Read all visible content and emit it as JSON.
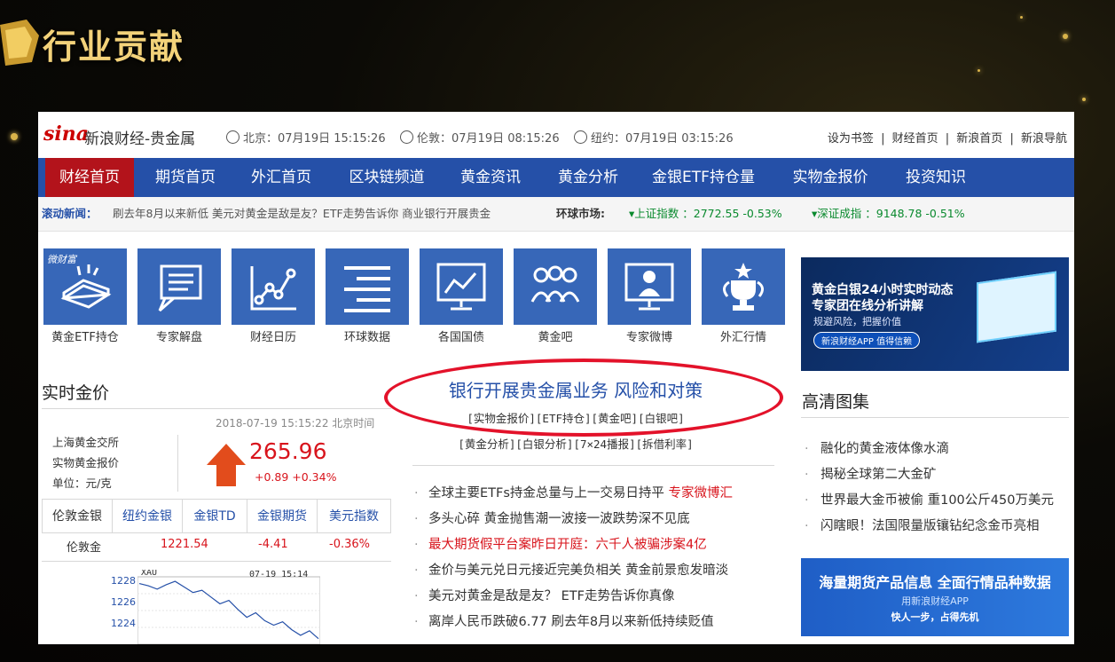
{
  "slide_title": "行业贡献",
  "site": {
    "logo": "sina",
    "name": "新浪财经-贵金属",
    "clocks": [
      "北京：07月19日 15:15:26",
      "伦敦：07月19日 08:15:26",
      "纽约：07月19日 03:15:26"
    ],
    "top_links": [
      "设为书签",
      "|",
      "财经首页",
      "|",
      "新浪首页",
      "|",
      "新浪导航"
    ]
  },
  "nav": [
    "财经首页",
    "期货首页",
    "外汇首页",
    "区块链频道",
    "黄金资讯",
    "黄金分析",
    "金银ETF持仓量",
    "实物金报价",
    "投资知识"
  ],
  "ticker": {
    "label": "滚动新闻：",
    "news": "刷去年8月以来新低   美元对黄金是敌是友？ETF走势告诉你   商业银行开展贵金",
    "market_label": "环球市场:",
    "index1": "▾上证指数 ：2772.55 -0.53%",
    "index2": "▾深证成指 ：9148.78 -0.51%"
  },
  "tiles": [
    {
      "label": "黄金ETF持仓",
      "badge": "微财富"
    },
    {
      "label": "专家解盘"
    },
    {
      "label": "财经日历"
    },
    {
      "label": "环球数据"
    },
    {
      "label": "各国国债"
    },
    {
      "label": "黄金吧"
    },
    {
      "label": "专家微博"
    },
    {
      "label": "外汇行情"
    }
  ],
  "ad1": {
    "line1": "黄金白银24小时实时动态",
    "line2": "专家团在线分析讲解",
    "line3": "规避风险，把握价值",
    "button": "新浪财经APP 值得信赖"
  },
  "realtime": {
    "title": "实时金价",
    "time": "2018-07-19 15:15:22 北京时间",
    "labels": [
      "上海黄金交所",
      "实物黄金报价",
      "单位：元/克"
    ],
    "price": "265.96",
    "change": "+0.89   +0.34%",
    "tabs": [
      "伦敦金银",
      "纽约金银",
      "金银TD",
      "金银期货",
      "美元指数"
    ],
    "row": {
      "name": "伦敦金",
      "price": "1221.54",
      "chg": "-4.41",
      "pct": "-0.36%"
    }
  },
  "chart_data": {
    "type": "line",
    "title": "XAU",
    "timestamp": "07-19 15:14",
    "yticks": [
      "1228",
      "1226",
      "1224"
    ],
    "values": [
      1228.4,
      1228.2,
      1227.9,
      1228.3,
      1228.6,
      1228.1,
      1227.6,
      1227.8,
      1227.2,
      1226.6,
      1226.9,
      1226.1,
      1225.4,
      1225.8,
      1225.1,
      1224.7,
      1225.0,
      1224.3,
      1223.8,
      1224.2,
      1223.5
    ],
    "ylim": [
      1223,
      1229
    ]
  },
  "headline": {
    "title": "银行开展贵金属业务 风险和对策",
    "links1": "[实物金报价][ETF持仓][黄金吧][白银吧]",
    "links2": "[黄金分析][白银分析][7×24播报][拆借利率]"
  },
  "news": [
    {
      "text": "全球主要ETFs持金总量与上一交易日持平 ",
      "tag": "专家微博汇",
      "red": false
    },
    {
      "text": "多头心碎 黄金抛售潮一波接一波跌势深不见底",
      "tag": "",
      "red": false
    },
    {
      "text": "最大期货假平台案昨日开庭：六千人被骗涉案4亿",
      "tag": "",
      "red": true
    },
    {
      "text": "金价与美元兑日元接近完美负相关 黄金前景愈发暗淡",
      "tag": "",
      "red": false
    },
    {
      "text": "美元对黄金是敌是友？ ETF走势告诉你真像",
      "tag": "",
      "red": false
    },
    {
      "text": "离岸人民币跌破6.77 刷去年8月以来新低持续贬值",
      "tag": "",
      "red": false
    }
  ],
  "gallery": {
    "title": "高清图集",
    "items": [
      "融化的黄金液体像水滴",
      "揭秘全球第二大金矿",
      "世界最大金币被偷 重100公斤450万美元",
      "闪瞎眼！法国限量版镶钻纪念金币亮相"
    ]
  },
  "ad2": {
    "line1": "海量期货产品信息 全面行情品种数据",
    "line2": "用新浪财经APP",
    "line3": "快人一步，占得先机"
  }
}
